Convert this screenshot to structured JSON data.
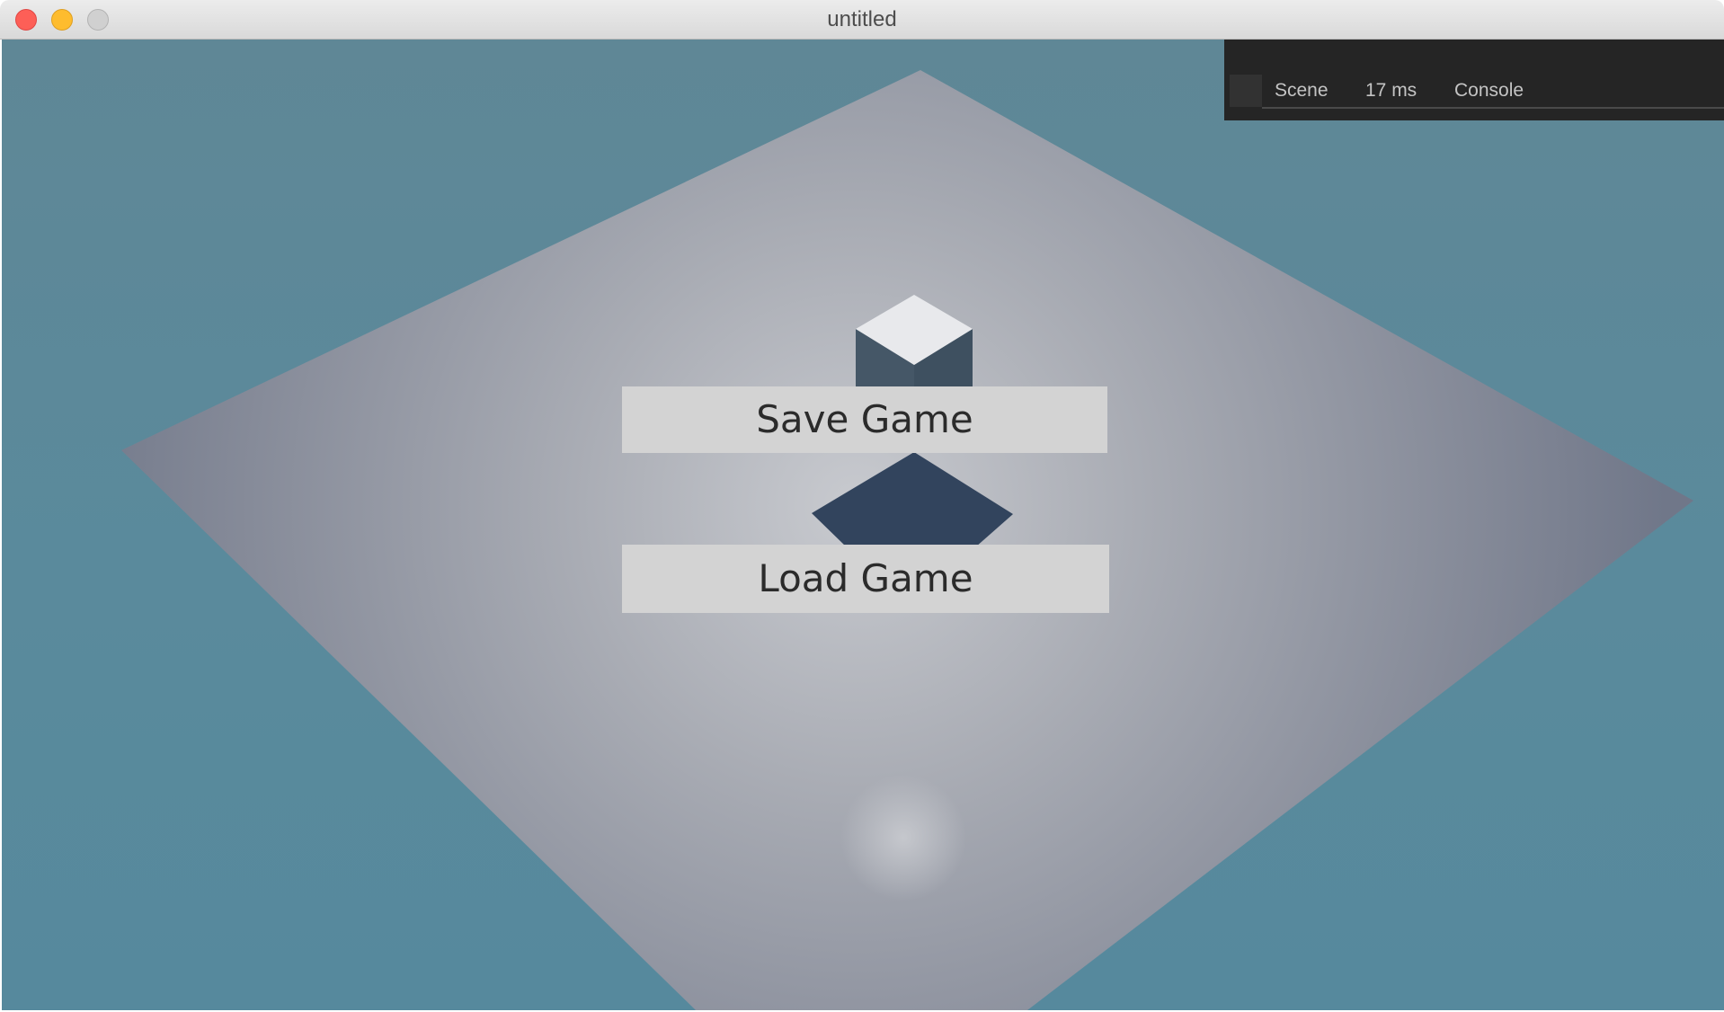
{
  "window": {
    "title": "untitled"
  },
  "debug_bar": {
    "tabs": [
      "Scene",
      "17 ms",
      "Console"
    ]
  },
  "menu": {
    "save_label": "Save Game",
    "load_label": "Load Game"
  },
  "colors": {
    "background": "#5a8a9c",
    "floor_edge": "#7a8192",
    "floor_center": "#c4c6cb",
    "cube_top": "#e8e9ec",
    "cube_side": "#455767",
    "shadow": "#32445d",
    "button_bg": "#d3d3d3"
  }
}
